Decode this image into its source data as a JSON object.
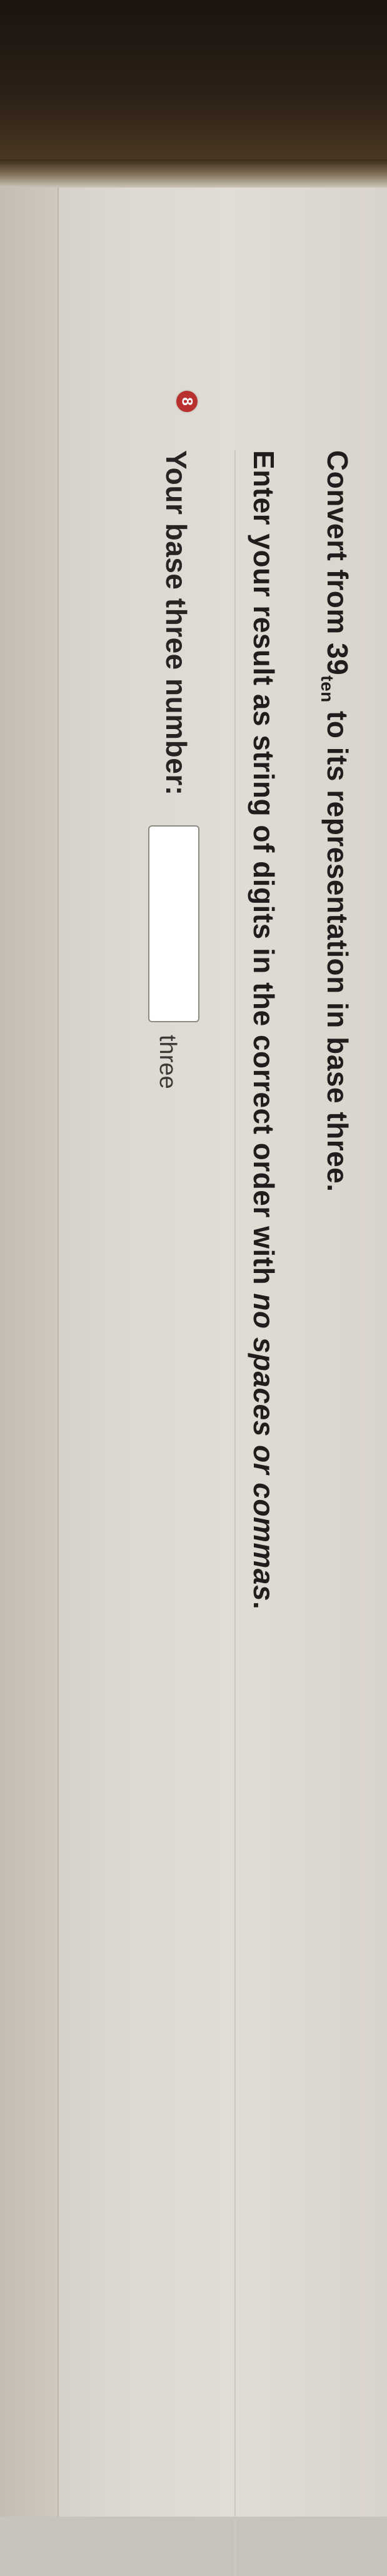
{
  "question": {
    "number": "8",
    "prompt_before": "Convert from ",
    "number_value": "39",
    "number_subscript": "ten",
    "prompt_after": " to its representation in base three.",
    "instruction_before": "Enter your result as string of digits in the correct order with ",
    "instruction_emphasis": "no spaces or commas",
    "instruction_after": ".",
    "answer_label": "Your base three number:",
    "answer_value": "",
    "answer_unit": "three"
  },
  "colors": {
    "badge": "#b8312f",
    "text": "#1f1e1c",
    "screen": "#dcd8d1",
    "bezel": "#2b2016"
  }
}
